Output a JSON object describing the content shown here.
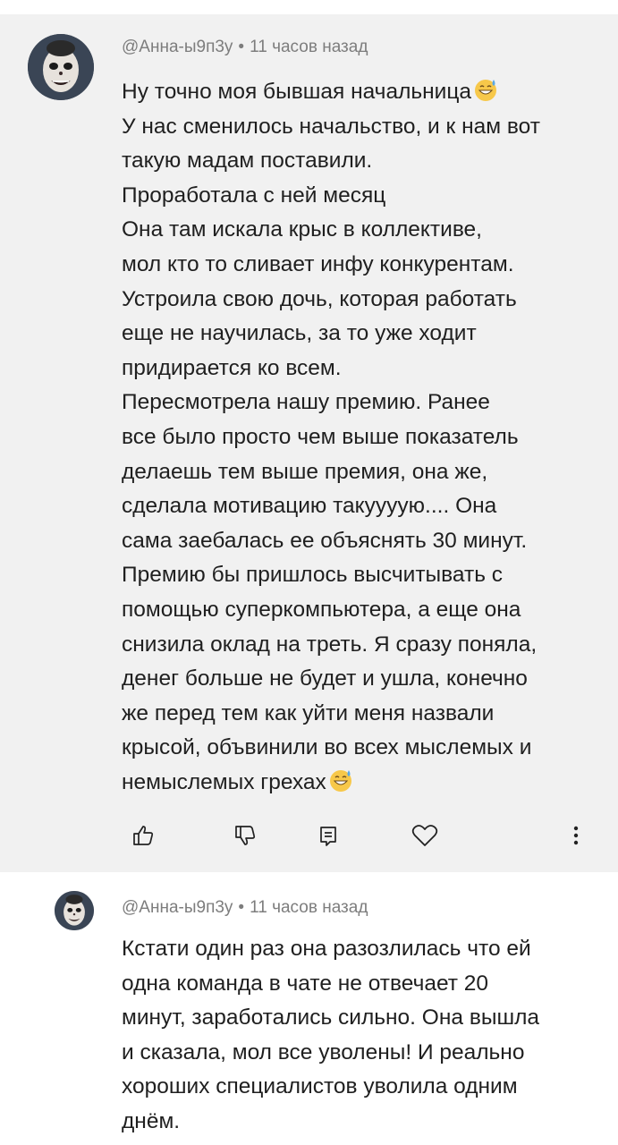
{
  "comments": [
    {
      "author": "@Анна-ы9п3у",
      "time": "11 часов назад",
      "lines": [
        "Ну точно моя бывшая начальница",
        "У нас сменилось начальство, и к нам вот",
        "такую мадам поставили.",
        "Проработала с ней месяц",
        "Она там искала крыс в коллективе,",
        "мол кто то сливает инфу конкурентам.",
        "Устроила свою дочь, которая работать",
        "еще не научилась, за то уже ходит",
        "придирается ко всем.",
        "Пересмотрела нашу премию. Ранее",
        "все было просто чем выше показатель",
        "делаешь тем выше премия, она же,",
        "сделала мотивацию такуууую.... Она",
        "сама заебалась ее объяснять 30 минут.",
        "Премию бы пришлось высчитывать с",
        "помощью суперкомпьютера, а еще она",
        "снизила оклад на треть. Я сразу поняла,",
        "денег больше не будет и ушла, конечно",
        "же перед тем как уйти меня назвали",
        "крысой, объвинили во всех мыслемых и",
        "немыслемых грехах"
      ],
      "emoji_icon": "grinning-sweat-emoji",
      "actions": [
        "like-icon",
        "dislike-icon",
        "reply-icon",
        "heart-icon",
        "more-vertical-icon"
      ]
    },
    {
      "author": "@Анна-ы9п3у",
      "time": "11 часов назад",
      "lines": [
        "Кстати один раз она разозлилась что ей",
        "одна команда в чате не отвечает 20",
        "минут, заработались сильно. Она вышла",
        "и сказала, мол все уволены! И реально",
        "хороших специалистов уволила одним",
        "днём."
      ]
    }
  ],
  "colors": {
    "highlight_bg": "#f1f1f1",
    "meta_text": "#7d7d7d",
    "body_text": "#1f1f1f"
  }
}
